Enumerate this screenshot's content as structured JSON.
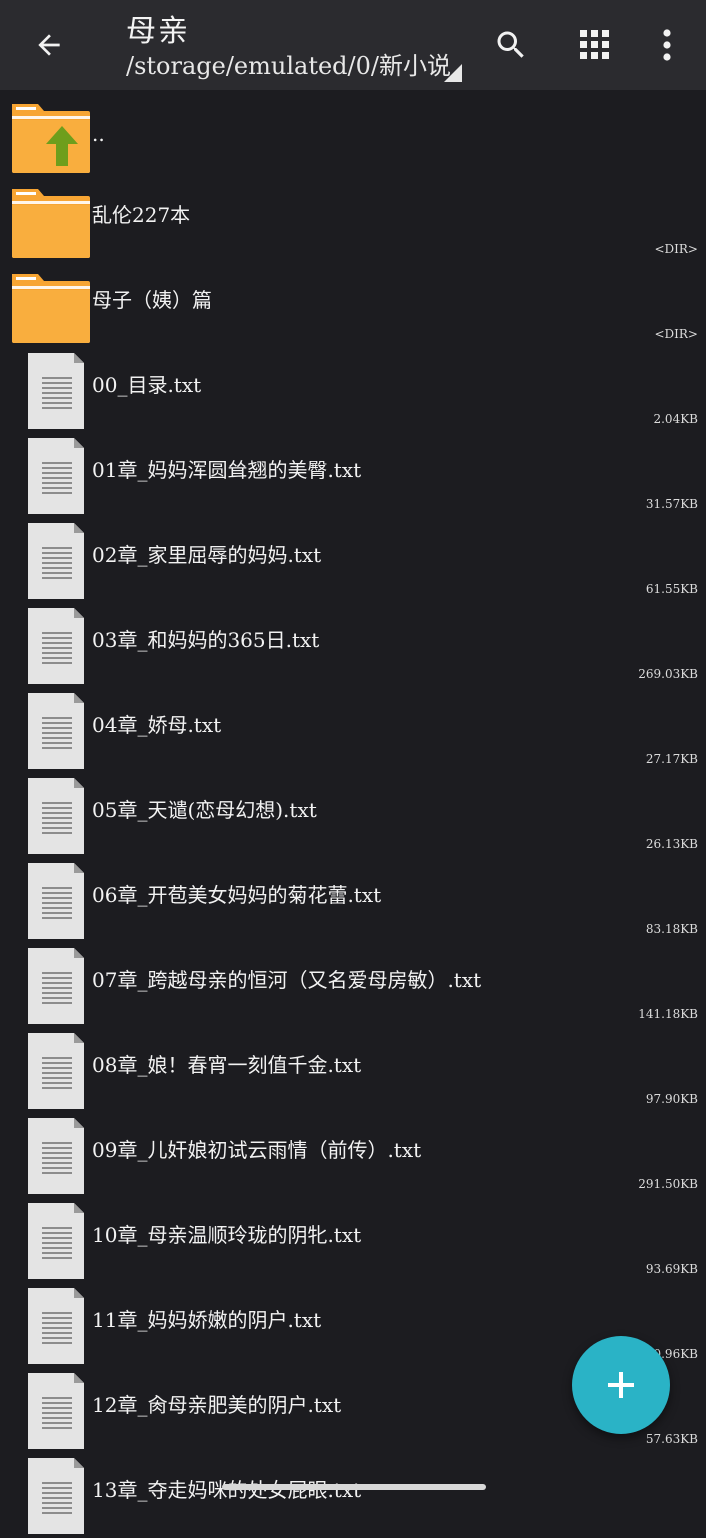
{
  "toolbar": {
    "title": "母亲",
    "path": "/storage/emulated/0/新小说",
    "back_icon": "arrow-left-icon",
    "search_icon": "search-icon",
    "grid_icon": "grid-view-icon",
    "more_icon": "more-vert-icon"
  },
  "colors": {
    "toolbar_bg": "#2b2b2f",
    "list_bg": "#1c1c20",
    "folder": "#f7a534",
    "up_arrow": "#6e9e1c",
    "fab": "#2ab3c6"
  },
  "files": [
    {
      "name": "..",
      "size": "",
      "type": "up"
    },
    {
      "name": "乱伦227本",
      "size": "<DIR>",
      "type": "folder"
    },
    {
      "name": "母子（姨）篇",
      "size": "<DIR>",
      "type": "folder"
    },
    {
      "name": "00_目录.txt",
      "size": "2.04KB",
      "type": "file"
    },
    {
      "name": "01章_妈妈浑圆耸翘的美臀.txt",
      "size": "31.57KB",
      "type": "file"
    },
    {
      "name": "02章_家里屈辱的妈妈.txt",
      "size": "61.55KB",
      "type": "file"
    },
    {
      "name": "03章_和妈妈的365日.txt",
      "size": "269.03KB",
      "type": "file"
    },
    {
      "name": "04章_娇母.txt",
      "size": "27.17KB",
      "type": "file"
    },
    {
      "name": "05章_天谴(恋母幻想).txt",
      "size": "26.13KB",
      "type": "file"
    },
    {
      "name": "06章_开苞美女妈妈的菊花蕾.txt",
      "size": "83.18KB",
      "type": "file"
    },
    {
      "name": "07章_跨越母亲的恒河（又名爱母房敏）.txt",
      "size": "141.18KB",
      "type": "file"
    },
    {
      "name": "08章_娘！春宵一刻值千金.txt",
      "size": "97.90KB",
      "type": "file"
    },
    {
      "name": "09章_儿奸娘初试云雨情（前传）.txt",
      "size": "291.50KB",
      "type": "file"
    },
    {
      "name": "10章_母亲温顺玲珑的阴牝.txt",
      "size": "93.69KB",
      "type": "file"
    },
    {
      "name": "11章_妈妈娇嫩的阴户.txt",
      "size": "0.96KB",
      "type": "file"
    },
    {
      "name": "12章_肏母亲肥美的阴户.txt",
      "size": "57.63KB",
      "type": "file"
    },
    {
      "name": "13章_夺走妈咪的处女屁眼.txt",
      "size": "",
      "type": "file"
    }
  ],
  "fab": {
    "icon": "plus-icon"
  }
}
